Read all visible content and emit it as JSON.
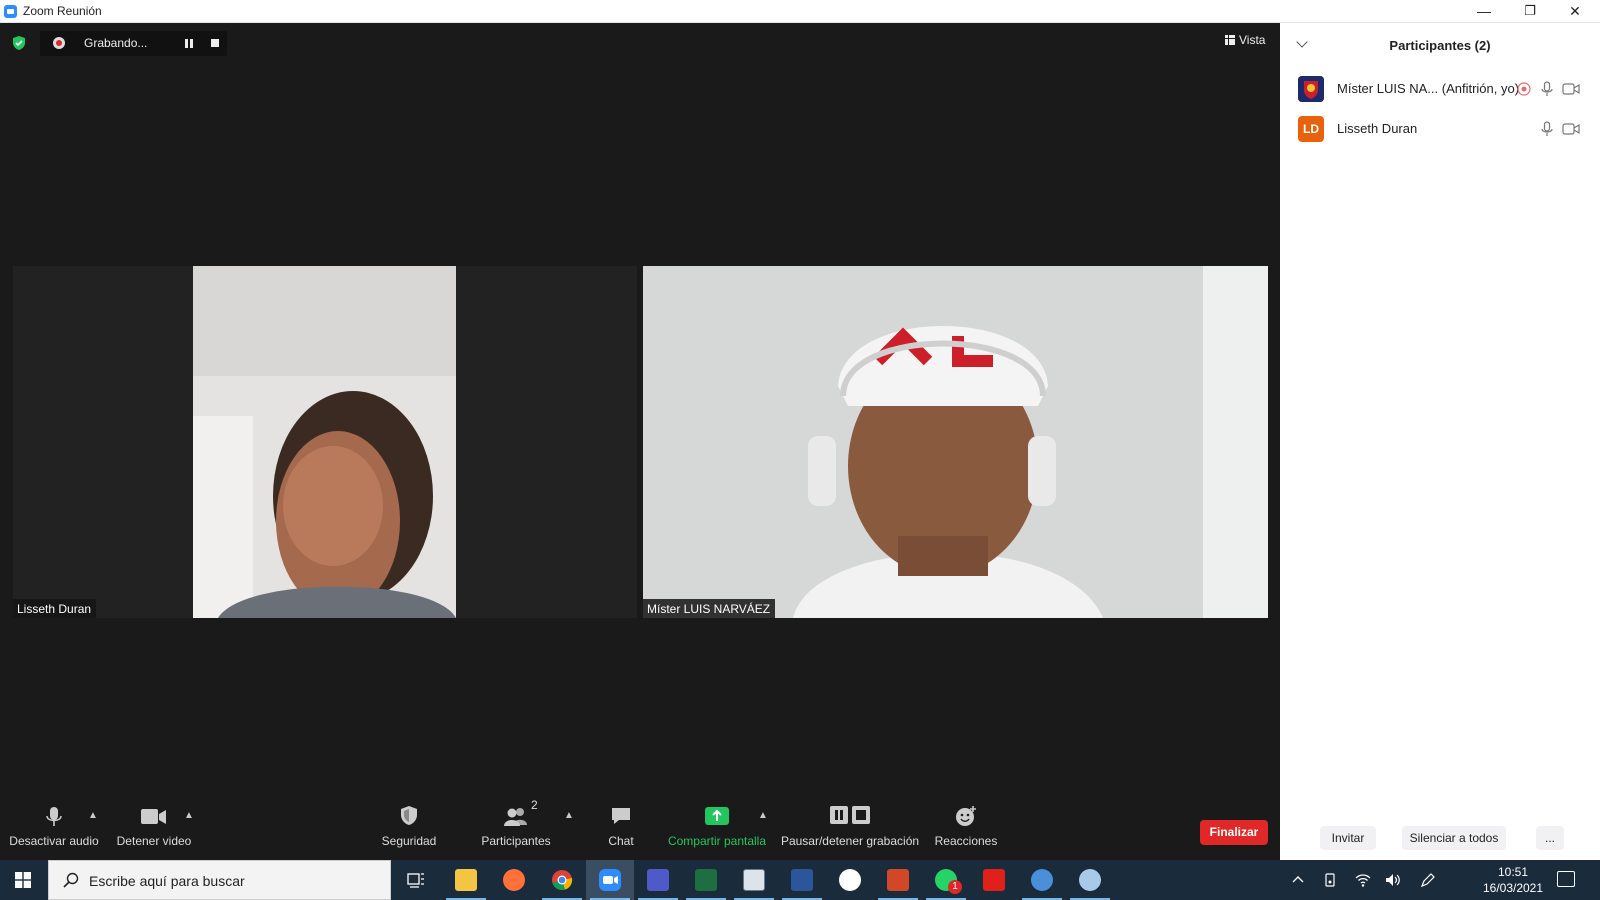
{
  "window": {
    "title": "Zoom Reunión",
    "controls": {
      "minimize": "—",
      "restore": "❐",
      "close": "✕"
    }
  },
  "meeting": {
    "recording_label": "Grabando...",
    "view_label": "Vista",
    "tiles": [
      {
        "name": "Lisseth Duran"
      },
      {
        "name": "Míster LUIS NARVÁEZ"
      }
    ]
  },
  "toolbar": {
    "mute_label": "Desactivar audio",
    "video_label": "Detener video",
    "security_label": "Seguridad",
    "participants_label": "Participantes",
    "participants_count": "2",
    "chat_label": "Chat",
    "share_label": "Compartir pantalla",
    "record_label": "Pausar/detener grabación",
    "reactions_label": "Reacciones",
    "end_label": "Finalizar",
    "colors": {
      "share": "#22c55e",
      "end": "#e02828"
    }
  },
  "participants_panel": {
    "title": "Participantes (2)",
    "participants": [
      {
        "name": "Míster LUIS NA... (Anfitrión, yo)",
        "avatar_text": "",
        "avatar_color": "#7a1f2b"
      },
      {
        "name": "Lisseth Duran",
        "avatar_text": "LD",
        "avatar_color": "#e8620c"
      }
    ],
    "invite_label": "Invitar",
    "mute_all_label": "Silenciar a todos",
    "more_label": "..."
  },
  "taskbar": {
    "search_placeholder": "Escribe aquí para buscar",
    "time": "10:51",
    "date": "16/03/2021",
    "whatsapp_badge": "1",
    "apps": [
      {
        "name": "task-view-icon"
      },
      {
        "name": "file-explorer-icon"
      },
      {
        "name": "firefox-icon"
      },
      {
        "name": "chrome-icon"
      },
      {
        "name": "zoom-icon"
      },
      {
        "name": "teams-icon"
      },
      {
        "name": "excel-icon"
      },
      {
        "name": "app-icon"
      },
      {
        "name": "word-icon"
      },
      {
        "name": "app-icon"
      },
      {
        "name": "powerpoint-icon"
      },
      {
        "name": "whatsapp-icon"
      },
      {
        "name": "acrobat-icon"
      },
      {
        "name": "app-icon"
      },
      {
        "name": "paint-icon"
      }
    ]
  }
}
